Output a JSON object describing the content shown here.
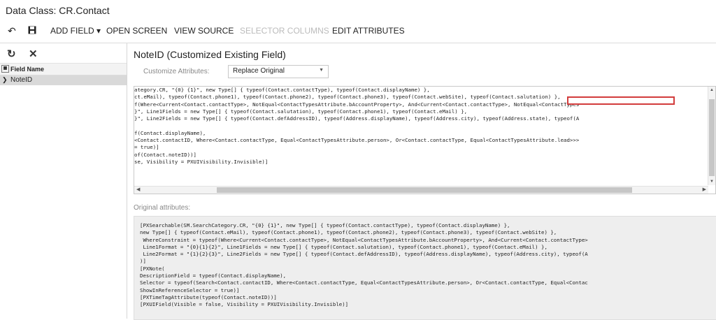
{
  "page": {
    "title": "Data Class: CR.Contact"
  },
  "toolbar": {
    "undo_icon": "undo-icon",
    "save_icon": "save-icon",
    "add_field": "ADD FIELD ▾",
    "open_screen": "OPEN SCREEN",
    "view_source": "VIEW SOURCE",
    "selector_columns": "SELECTOR COLUMNS",
    "edit_attributes": "EDIT ATTRIBUTES"
  },
  "left_pane": {
    "refresh_icon": "refresh-icon",
    "close_icon": "close-icon",
    "column_header": "Field Name",
    "rows": [
      "NoteID"
    ]
  },
  "detail": {
    "title": "NoteID (Customized Existing Field)",
    "customize_label": "Customize Attributes:",
    "customize_value": "Replace Original"
  },
  "editor": {
    "lines": [
      "ategory.CR, \"{0} {1}\", new Type[] { typeof(Contact.contactType), typeof(Contact.displayName) },",
      "ct.eMail), typeof(Contact.phone1), typeof(Contact.phone2), typeof(Contact.phone3), typeof(Contact.webSite), typeof(Contact.salutation) },",
      "f(Where<Current<Contact.contactType>, NotEqual<ContactTypesAttribute.bAccountProperty>, And<Current<Contact.contactType>, NotEqual<ContactTypes",
      "}\", Line1Fields = new Type[] { typeof(Contact.salutation), typeof(Contact.phone1), typeof(Contact.eMail) },",
      "}\", Line2Fields = new Type[] { typeof(Contact.defAddressID), typeof(Address.displayName), typeof(Address.city), typeof(Address.state), typeof(A",
      "",
      "f(Contact.displayName),",
      "<Contact.contactID, Where<Contact.contactType, Equal<ContactTypesAttribute.person>, Or<Contact.contactType, Equal<ContactTypesAttribute.lead>>>",
      "= true)]",
      "of(Contact.noteID))]",
      "se, Visibility = PXUIVisibility.Invisible)]"
    ]
  },
  "original": {
    "label": "Original attributes:",
    "lines": [
      "[PXSearchable(SM.SearchCategory.CR, \"{0} {1}\", new Type[] { typeof(Contact.contactType), typeof(Contact.displayName) },",
      "new Type[] { typeof(Contact.eMail), typeof(Contact.phone1), typeof(Contact.phone2), typeof(Contact.phone3), typeof(Contact.webSite) },",
      " WhereConstraint = typeof(Where<Current<Contact.contactType>, NotEqual<ContactTypesAttribute.bAccountProperty>, And<Current<Contact.contactType>",
      " Line1Format = \"{0}{1}{2}\", Line1Fields = new Type[] { typeof(Contact.salutation), typeof(Contact.phone1), typeof(Contact.eMail) },",
      " Line2Format = \"{1}{2}{3}\", Line2Fields = new Type[] { typeof(Contact.defAddressID), typeof(Address.displayName), typeof(Address.city), typeof(A",
      ")]",
      "[PXNote(",
      "DescriptionField = typeof(Contact.displayName),",
      "Selector = typeof(Search<Contact.contactID, Where<Contact.contactType, Equal<ContactTypesAttribute.person>, Or<Contact.contactType, Equal<Contac",
      "ShowInReferenceSelector = true)]",
      "[PXTimeTagAttribute(typeof(Contact.noteID))]",
      "[PXUIField(Visible = false, Visibility = PXUIVisibility.Invisible)]"
    ]
  },
  "colors": {
    "highlight": "#d23c3c",
    "disabled_text": "#bbbbbb",
    "selected_row": "#d9d9d9"
  }
}
